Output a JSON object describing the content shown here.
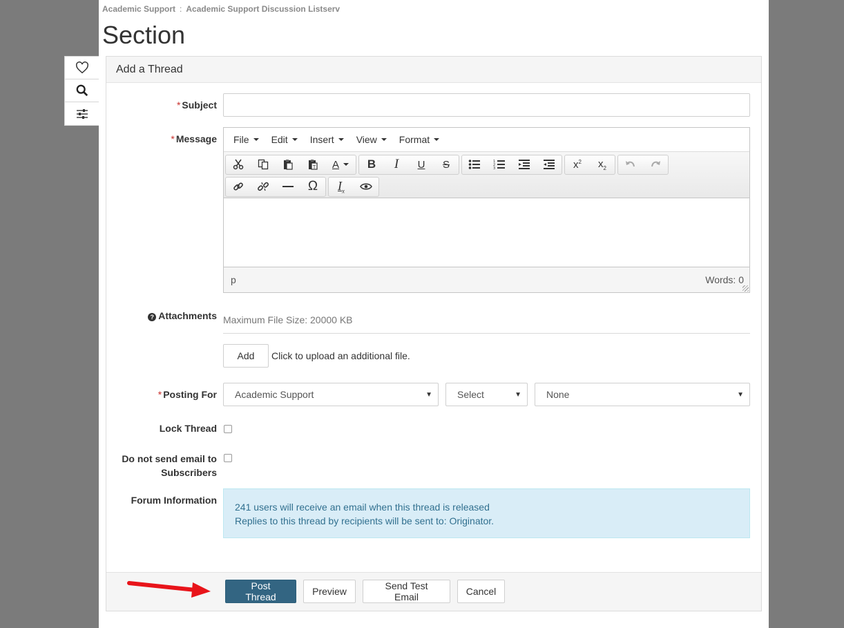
{
  "breadcrumb": {
    "items": [
      "Academic Support",
      "Academic Support Discussion Listserv"
    ],
    "separator": ":"
  },
  "page_title": "Section",
  "sidetools": [
    "heart-icon",
    "search-icon",
    "sliders-icon"
  ],
  "panel": {
    "title": "Add a Thread"
  },
  "subject": {
    "label": "Subject",
    "value": "",
    "placeholder": ""
  },
  "message": {
    "label": "Message",
    "menus": [
      "File",
      "Edit",
      "Insert",
      "View",
      "Format"
    ],
    "status_path": "p",
    "word_count": "Words: 0"
  },
  "attachments": {
    "label": "Attachments",
    "max_size": "Maximum File Size: 20000 KB",
    "add_label": "Add",
    "hint": "Click to upload an additional file."
  },
  "posting_for": {
    "label": "Posting For",
    "select1": "Academic Support",
    "select2": "Select",
    "select3": "None"
  },
  "lock_thread": {
    "label": "Lock Thread",
    "checked": false
  },
  "no_email": {
    "label_line1": "Do not send email to",
    "label_line2": "Subscribers",
    "checked": false
  },
  "forum_info": {
    "label": "Forum Information",
    "line1": "241 users will receive an email when this thread is released",
    "line2": "Replies to this thread by recipients will be sent to: Originator."
  },
  "footer": {
    "post_label": "Post Thread",
    "preview_label": "Preview",
    "test_email_label": "Send Test Email",
    "cancel_label": "Cancel"
  },
  "colors": {
    "primary": "#336582",
    "info_bg": "#d9edf7",
    "info_text": "#31708f",
    "required": "#c9302c",
    "annotation_arrow": "#e8141a"
  }
}
